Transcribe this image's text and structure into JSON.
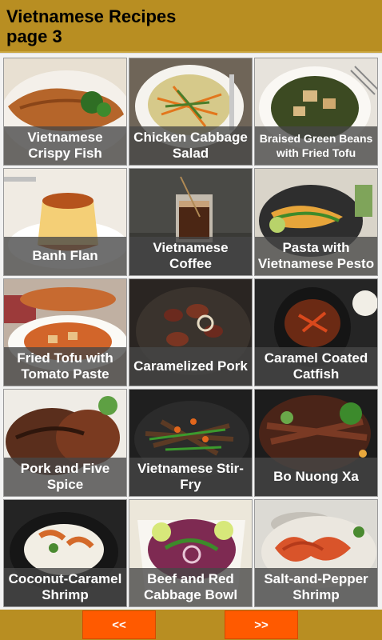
{
  "header": {
    "title_line1": "Vietnamese Recipes",
    "title_line2": "page 3"
  },
  "recipes": [
    {
      "name": "Vietnamese Crispy Fish"
    },
    {
      "name": "Chicken Cabbage Salad"
    },
    {
      "name": "Braised Green Beans with Fried Tofu"
    },
    {
      "name": "Banh Flan"
    },
    {
      "name": "Vietnamese Coffee"
    },
    {
      "name": "Pasta with Vietnamese Pesto"
    },
    {
      "name": "Fried Tofu with Tomato Paste"
    },
    {
      "name": "Caramelized Pork"
    },
    {
      "name": "Caramel Coated Catfish"
    },
    {
      "name": "Pork and Five Spice"
    },
    {
      "name": "Vietnamese Stir-Fry"
    },
    {
      "name": "Bo Nuong Xa"
    },
    {
      "name": "Coconut-Caramel Shrimp"
    },
    {
      "name": "Beef and Red Cabbage Bowl"
    },
    {
      "name": "Salt-and-Pepper Shrimp"
    }
  ],
  "nav": {
    "prev_label": "<<",
    "next_label": ">>"
  },
  "colors": {
    "header_bg": "#b88e22",
    "button_bg": "#ff5a00"
  }
}
